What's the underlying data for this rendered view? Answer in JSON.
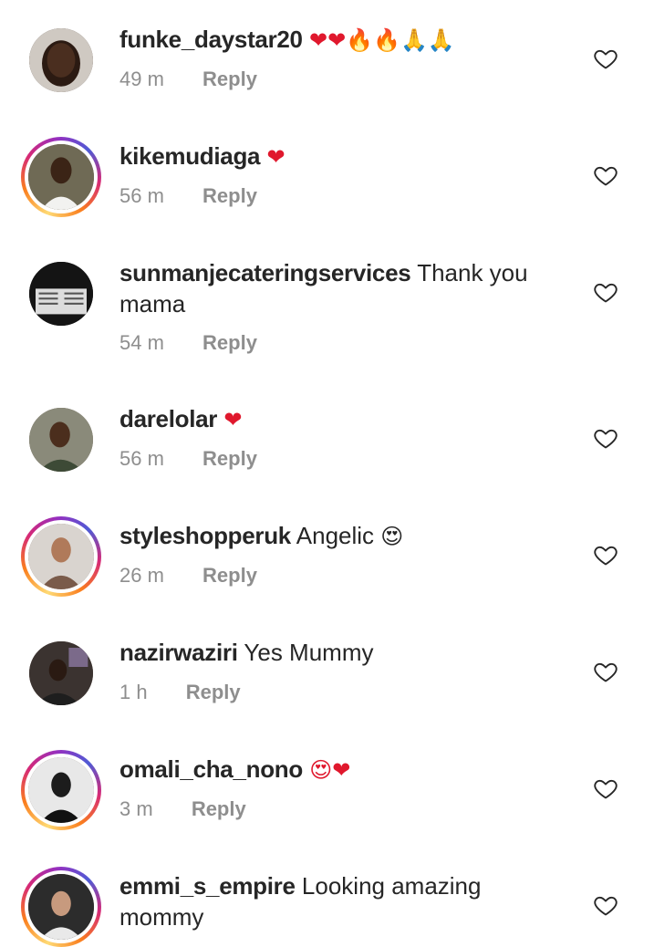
{
  "comments": [
    {
      "username": "funke_daystar20",
      "text": "",
      "emoji": "❤❤🔥🔥🙏🙏",
      "time": "49 m",
      "reply": "Reply",
      "story": false
    },
    {
      "username": "kikemudiaga",
      "text": "",
      "emoji": "❤",
      "time": "56 m",
      "reply": "Reply",
      "story": true
    },
    {
      "username": "sunmanjecateringservices",
      "text": "Thank you mama",
      "emoji": "",
      "time": "54 m",
      "reply": "Reply",
      "story": false
    },
    {
      "username": "darelolar",
      "text": "",
      "emoji": "❤",
      "time": "56 m",
      "reply": "Reply",
      "story": false
    },
    {
      "username": "styleshopperuk",
      "text": "Angelic",
      "emoji": "😍",
      "time": "26 m",
      "reply": "Reply",
      "story": true
    },
    {
      "username": "nazirwaziri",
      "text": "Yes Mummy",
      "emoji": "",
      "time": "1 h",
      "reply": "Reply",
      "story": false
    },
    {
      "username": "omali_cha_nono",
      "text": "",
      "emoji": "😍❤",
      "time": "3 m",
      "reply": "Reply",
      "story": true
    },
    {
      "username": "emmi_s_empire",
      "text": "Looking amazing mommy",
      "emoji": "",
      "time": "",
      "reply": "",
      "story": true
    }
  ],
  "colors": {
    "heart_red": "#e0182d",
    "meta_gray": "#8e8e8e",
    "text": "#262626"
  },
  "icons": {
    "like": "heart-outline-icon"
  }
}
